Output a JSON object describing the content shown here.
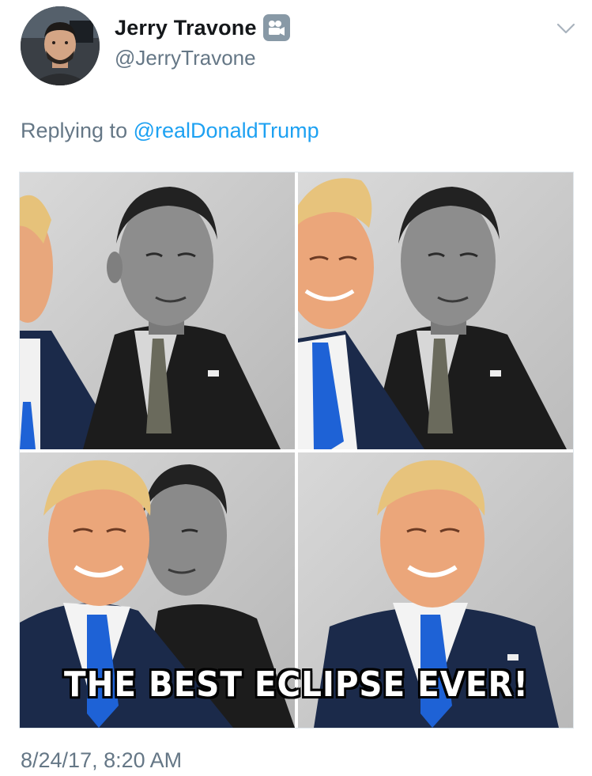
{
  "tweet": {
    "author": {
      "display_name": "Jerry Travone",
      "handle": "@JerryTravone",
      "badge_icon": "video-camera-icon",
      "avatar_icon": "user-avatar-icon"
    },
    "menu_icon": "chevron-down-icon",
    "reply": {
      "prefix": "Replying to",
      "mention": "@realDonaldTrump"
    },
    "media": {
      "panel_count": 4,
      "caption": "THE BEST ECLIPSE EVER!"
    },
    "timestamp": "8/24/17, 8:20 AM"
  },
  "colors": {
    "text": "#14171a",
    "secondary": "#657786",
    "link": "#1da1f2",
    "border": "#e1e8ed",
    "blue_tie": "#1e62d6"
  }
}
